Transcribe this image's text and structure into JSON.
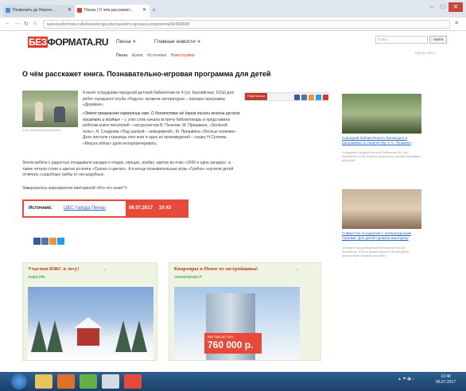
{
  "browser": {
    "tabs": [
      {
        "title": "Позвонить до Нового..."
      },
      {
        "title": "Пенза | О чём расскажет..."
      }
    ],
    "url": "www.bezformata.ru/listnews/kniga-poznavatelno-igrovaya-programma/56958898/"
  },
  "header": {
    "logo_a": "БЕЗ",
    "logo_b": "ФОРМАТА.RU",
    "city": "Пенза",
    "main_news": "Главные новости",
    "subnav": [
      "Пенза",
      "Архив",
      "Источники",
      "Новостройки"
    ],
    "search_placeholder": "Поиск",
    "search_button": "Найти",
    "site_menu": "Карта сайта"
  },
  "article": {
    "title": "О чём расскажет книга. Познавательно-игровая программа для детей",
    "photo_caption": "Фото: пензенская библиотека",
    "p1": "4 июля сотрудники городской детской библиотеки № 4 (ул. Каспийская, 102а) для ребят городского клуба «Радуга» провели литературно – игровую программу «Деревня».",
    "p2_italic": "«Земля прекрасная кормилица нам. О богатствах её даров писали многие русские писатели и поэты»",
    "p2_rest": "– с этих слов начала встречу библиотекарь и представила ребятам книги писателей – натуралистов В. Пескова, М. Пришвина, «Зелёной поль», Н. Сладкова «Под шапкой – невидимкой», М. Пришвина «Лесные хозяева». Дети листали страницы этих книг и одно из произведений – сказку Н.Сутеева «Мешок яблок» дали интерпретировать.",
    "p3": "Затем ребята с радостью отгадывали загадки о ягодах, овощах, грибах, цветах во очко «1000 и одна загадка», а также читали стихи о цветах из книги «Сказка о цветах». А в конце познавательные игры «Грибок» научили детей отличать съедобные грибы от несъедобных.",
    "p4": "Завершилось мероприятие викториной «Кто что знает?»",
    "share_label": "Поделиться"
  },
  "source": {
    "label": "Источник:",
    "name": "ЦБС города Пензы",
    "date": "06.07.2017",
    "time": "10:43"
  },
  "ads": [
    {
      "title": "Участки ИЖС в лесу!",
      "site": "ooipd.info"
    },
    {
      "title": "Квартиры в Пензе от застройщика!",
      "site": "oosvaropnaia.rf",
      "price_small": "ВЫГОДА ДО 15%",
      "price_big": "760 000 р."
    }
  ],
  "sidebar": [
    {
      "title": "Сценарий библиотечного Лукоморья и программы по творчеству А. С. Пушкина",
      "text": "Сотрудники городской детской библиотеки № 4 (ул. Каспийская, 102а) провели литературно-игровую программу для детей..."
    },
    {
      "title": "Совместно по дорогам с литературными героями. Для детей провели викторину",
      "text": "13 июля в городской детской библиотеке №4 (ул. Каспийская, 102а) в рамках проекта «Литературное путешествие» провели для ребят..."
    }
  ],
  "taskbar": {
    "time": "10:48",
    "date": "06.07.2017"
  },
  "colors": {
    "brand_red": "#e2372b",
    "link_blue": "#2a6bbf",
    "ad_green": "#3b8a2f"
  }
}
